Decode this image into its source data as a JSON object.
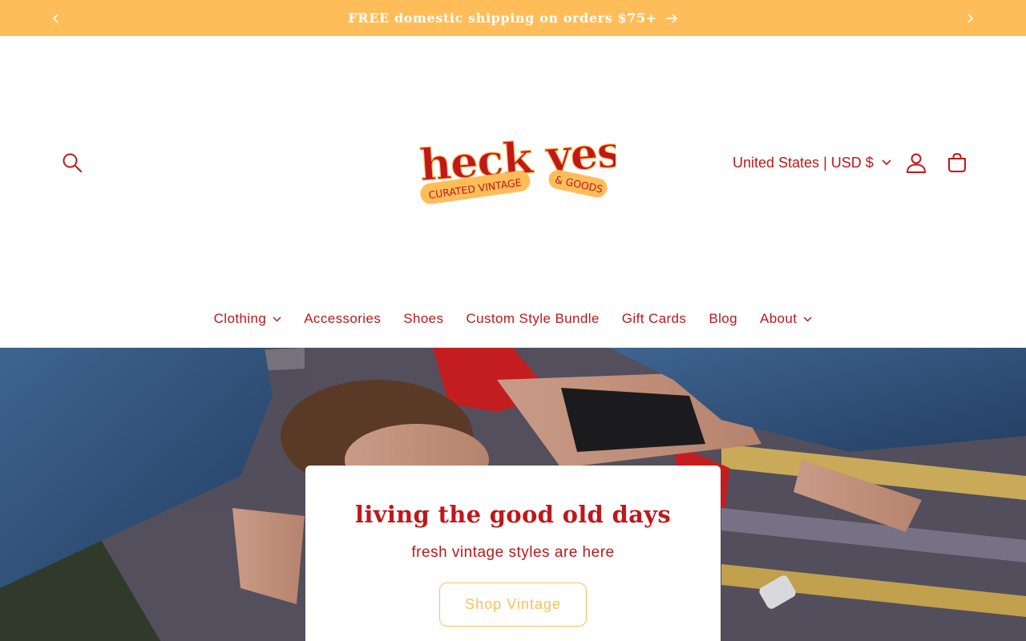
{
  "announcement": {
    "text": "FREE domestic shipping on orders $75+"
  },
  "header": {
    "logo": {
      "main": "heck yes",
      "tag_left": "CURATED VINTAGE",
      "tag_right": "& GOODS"
    },
    "country_selector": "United States | USD $",
    "nav": [
      {
        "label": "Clothing",
        "has_dropdown": true
      },
      {
        "label": "Accessories",
        "has_dropdown": false
      },
      {
        "label": "Shoes",
        "has_dropdown": false
      },
      {
        "label": "Custom Style Bundle",
        "has_dropdown": false
      },
      {
        "label": "Gift Cards",
        "has_dropdown": false
      },
      {
        "label": "Blog",
        "has_dropdown": false
      },
      {
        "label": "About",
        "has_dropdown": true
      }
    ]
  },
  "hero": {
    "title": "living the good old days",
    "subtitle": "fresh vintage styles are here",
    "button": "Shop Vintage"
  },
  "icons": {
    "search": "search-icon",
    "account": "account-icon",
    "cart": "cart-icon",
    "prev": "chevron-left-icon",
    "next": "chevron-right-icon",
    "arrow": "arrow-right-icon",
    "dropdown": "chevron-down-icon"
  },
  "colors": {
    "brand_red": "#c0171a",
    "announcement_bg": "#ffbd5a",
    "accent_orange": "#ffbd5a"
  }
}
